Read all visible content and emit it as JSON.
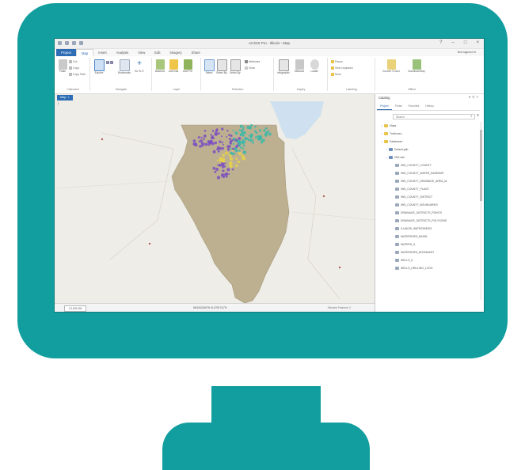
{
  "colors": {
    "monitor": "#129e9e",
    "accent": "#2d6db5",
    "illinois": "#bdb091",
    "lake": "#cfe1f0",
    "points_purple": "#7b4fc1",
    "points_teal": "#38b8a8",
    "points_yellow": "#e8d24a"
  },
  "window": {
    "title": "ArcGIS Pro - Illinois - Map"
  },
  "tabs": [
    {
      "label": "Project"
    },
    {
      "label": "Map"
    },
    {
      "label": "Insert"
    },
    {
      "label": "Analysis"
    },
    {
      "label": "View"
    },
    {
      "label": "Edit"
    },
    {
      "label": "Imagery"
    },
    {
      "label": "Share"
    }
  ],
  "signin": "Not signed in",
  "ribbon": {
    "groups": {
      "clipboard": "Clipboard",
      "navigate": "Navigate",
      "layer": "Layer",
      "selection": "Selection",
      "inquiry": "Inquiry",
      "labeling": "Labeling",
      "offline": "Offline"
    },
    "buttons": {
      "paste": "Paste",
      "explore": "Explore",
      "bookmarks": "Bookmarks",
      "go_to_xy": "Go To XY",
      "basemap": "Basemap",
      "add_data": "Add Data",
      "add_preset": "Add Preset",
      "select": "Select",
      "select_by_attributes": "Select By Attributes",
      "select_by_location": "Select By Location",
      "attributes": "Attributes",
      "clear": "Clear",
      "infographics": "Infographics",
      "measure": "Measure",
      "locate": "Locate",
      "convert_to_annotation": "Convert To Annotation",
      "download_map": "Download Map"
    },
    "small": {
      "cut": "Cut",
      "copy": "Copy",
      "copy_path": "Copy Path",
      "pause": "Pause",
      "view_unplaced": "View Unplaced",
      "more": "More"
    }
  },
  "map": {
    "tab_label": "Map",
    "scale": "1:3,000,000",
    "coordinates": "88.9062186°W 41.8751741°N",
    "selected_features": "Selected Features: 0"
  },
  "catalog": {
    "title": "Catalog",
    "tabs": [
      {
        "label": "Project"
      },
      {
        "label": "Portal"
      },
      {
        "label": "Favorites"
      },
      {
        "label": "History"
      }
    ],
    "search_placeholder": "Search",
    "items": [
      {
        "label": "Maps"
      },
      {
        "label": "Toolboxes"
      },
      {
        "label": "Databases"
      },
      {
        "label": "Default.gdb"
      },
      {
        "label": "IWS.sde"
      },
      {
        "label": "IWS_COUNTY_COUNTY"
      },
      {
        "label": "IWS_COUNTY_WATER_BASEMAP"
      },
      {
        "label": "IWS_COUNTY_DRAINAGE_AREA_IA"
      },
      {
        "label": "IWS_COUNTY_PLACE"
      },
      {
        "label": "IWS_COUNTY_DISTRICT"
      },
      {
        "label": "IWS_COUNTY_BOUNDARIES"
      },
      {
        "label": "DRAINAGE_DISTRICTS_POINTS"
      },
      {
        "label": "DRAINAGE_DISTRICTS_POLYGONS"
      },
      {
        "label": "ILLINOIS_WATERSHEDS"
      },
      {
        "label": "WATERSHED_BASIN"
      },
      {
        "label": "WATERS_IL"
      },
      {
        "label": "WATERSHED_BOUNDARY"
      },
      {
        "label": "WELLS_IL"
      },
      {
        "label": "WELLS_DRILLING_LOGS"
      }
    ]
  }
}
